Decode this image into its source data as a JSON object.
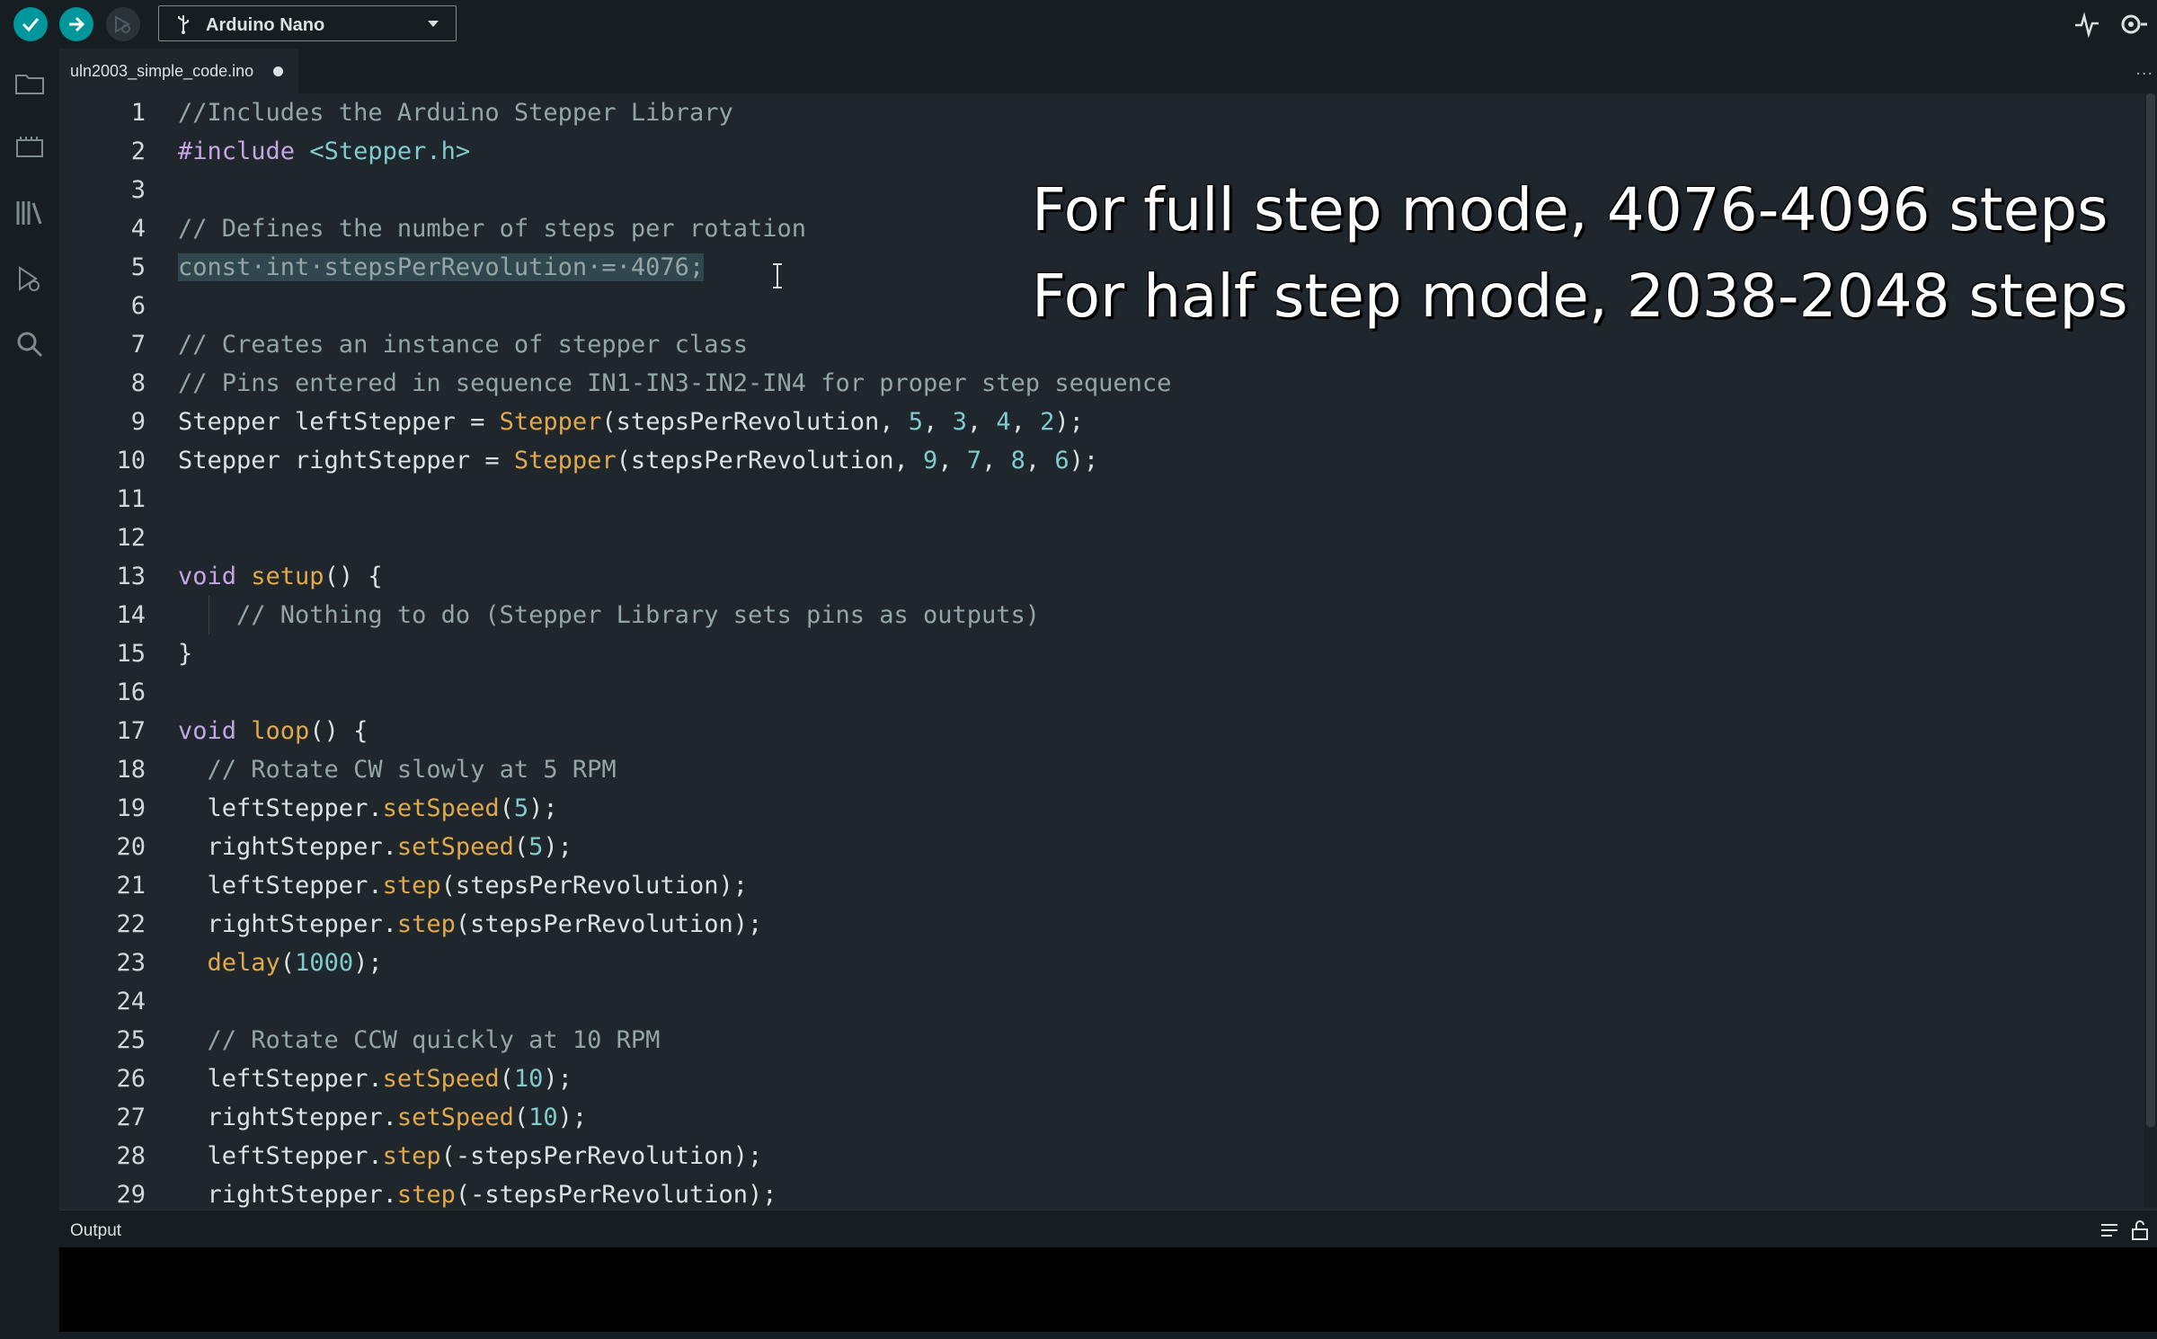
{
  "toolbar": {
    "board_name": "Arduino Nano"
  },
  "tab": {
    "filename": "uln2003_simple_code.ino",
    "more": "..."
  },
  "editor": {
    "lines": [
      {
        "n": "1",
        "segs": [
          {
            "t": "//Includes the Arduino Stepper Library",
            "c": "cmt"
          }
        ]
      },
      {
        "n": "2",
        "segs": [
          {
            "t": "#include ",
            "c": "pp"
          },
          {
            "t": "<Stepper.h>",
            "c": "inc"
          }
        ]
      },
      {
        "n": "3",
        "segs": []
      },
      {
        "n": "4",
        "segs": [
          {
            "t": "// Defines the number of steps per rotation",
            "c": "cmt"
          }
        ]
      },
      {
        "n": "5",
        "segs": [
          {
            "t": "const·int·stepsPerRevolution·=·4076;",
            "c": "sel"
          }
        ]
      },
      {
        "n": "6",
        "segs": []
      },
      {
        "n": "7",
        "segs": [
          {
            "t": "// Creates an instance of stepper class",
            "c": "cmt"
          }
        ]
      },
      {
        "n": "8",
        "segs": [
          {
            "t": "// Pins entered in sequence IN1-IN3-IN2-IN4 for proper step sequence",
            "c": "cmt"
          }
        ]
      },
      {
        "n": "9",
        "segs": [
          {
            "t": "Stepper leftStepper = ",
            "c": ""
          },
          {
            "t": "Stepper",
            "c": "fn"
          },
          {
            "t": "(stepsPerRevolution, ",
            "c": ""
          },
          {
            "t": "5",
            "c": "num"
          },
          {
            "t": ", ",
            "c": ""
          },
          {
            "t": "3",
            "c": "num"
          },
          {
            "t": ", ",
            "c": ""
          },
          {
            "t": "4",
            "c": "num"
          },
          {
            "t": ", ",
            "c": ""
          },
          {
            "t": "2",
            "c": "num"
          },
          {
            "t": ");",
            "c": ""
          }
        ]
      },
      {
        "n": "10",
        "segs": [
          {
            "t": "Stepper rightStepper = ",
            "c": ""
          },
          {
            "t": "Stepper",
            "c": "fn"
          },
          {
            "t": "(stepsPerRevolution, ",
            "c": ""
          },
          {
            "t": "9",
            "c": "num"
          },
          {
            "t": ", ",
            "c": ""
          },
          {
            "t": "7",
            "c": "num"
          },
          {
            "t": ", ",
            "c": ""
          },
          {
            "t": "8",
            "c": "num"
          },
          {
            "t": ", ",
            "c": ""
          },
          {
            "t": "6",
            "c": "num"
          },
          {
            "t": ");",
            "c": ""
          }
        ]
      },
      {
        "n": "11",
        "segs": []
      },
      {
        "n": "12",
        "segs": []
      },
      {
        "n": "13",
        "segs": [
          {
            "t": "void ",
            "c": "kw"
          },
          {
            "t": "setup",
            "c": "fn"
          },
          {
            "t": "() {",
            "c": ""
          }
        ]
      },
      {
        "n": "14",
        "guide": true,
        "segs": [
          {
            "t": "    // Nothing to do (Stepper Library sets pins as outputs)",
            "c": "cmt"
          }
        ]
      },
      {
        "n": "15",
        "segs": [
          {
            "t": "}",
            "c": ""
          }
        ]
      },
      {
        "n": "16",
        "segs": []
      },
      {
        "n": "17",
        "segs": [
          {
            "t": "void ",
            "c": "kw"
          },
          {
            "t": "loop",
            "c": "fn"
          },
          {
            "t": "() {",
            "c": ""
          }
        ]
      },
      {
        "n": "18",
        "segs": [
          {
            "t": "  // Rotate CW slowly at 5 RPM",
            "c": "cmt"
          }
        ]
      },
      {
        "n": "19",
        "segs": [
          {
            "t": "  leftStepper.",
            "c": ""
          },
          {
            "t": "setSpeed",
            "c": "fn"
          },
          {
            "t": "(",
            "c": ""
          },
          {
            "t": "5",
            "c": "num"
          },
          {
            "t": ");",
            "c": ""
          }
        ]
      },
      {
        "n": "20",
        "segs": [
          {
            "t": "  rightStepper.",
            "c": ""
          },
          {
            "t": "setSpeed",
            "c": "fn"
          },
          {
            "t": "(",
            "c": ""
          },
          {
            "t": "5",
            "c": "num"
          },
          {
            "t": ");",
            "c": ""
          }
        ]
      },
      {
        "n": "21",
        "segs": [
          {
            "t": "  leftStepper.",
            "c": ""
          },
          {
            "t": "step",
            "c": "fn"
          },
          {
            "t": "(stepsPerRevolution);",
            "c": ""
          }
        ]
      },
      {
        "n": "22",
        "segs": [
          {
            "t": "  rightStepper.",
            "c": ""
          },
          {
            "t": "step",
            "c": "fn"
          },
          {
            "t": "(stepsPerRevolution);",
            "c": ""
          }
        ]
      },
      {
        "n": "23",
        "segs": [
          {
            "t": "  ",
            "c": ""
          },
          {
            "t": "delay",
            "c": "fn"
          },
          {
            "t": "(",
            "c": ""
          },
          {
            "t": "1000",
            "c": "num"
          },
          {
            "t": ");",
            "c": ""
          }
        ]
      },
      {
        "n": "24",
        "segs": []
      },
      {
        "n": "25",
        "segs": [
          {
            "t": "  // Rotate CCW quickly at 10 RPM",
            "c": "cmt"
          }
        ]
      },
      {
        "n": "26",
        "segs": [
          {
            "t": "  leftStepper.",
            "c": ""
          },
          {
            "t": "setSpeed",
            "c": "fn"
          },
          {
            "t": "(",
            "c": ""
          },
          {
            "t": "10",
            "c": "num"
          },
          {
            "t": ");",
            "c": ""
          }
        ]
      },
      {
        "n": "27",
        "segs": [
          {
            "t": "  rightStepper.",
            "c": ""
          },
          {
            "t": "setSpeed",
            "c": "fn"
          },
          {
            "t": "(",
            "c": ""
          },
          {
            "t": "10",
            "c": "num"
          },
          {
            "t": ");",
            "c": ""
          }
        ]
      },
      {
        "n": "28",
        "segs": [
          {
            "t": "  leftStepper.",
            "c": ""
          },
          {
            "t": "step",
            "c": "fn"
          },
          {
            "t": "(-stepsPerRevolution);",
            "c": ""
          }
        ]
      },
      {
        "n": "29",
        "segs": [
          {
            "t": "  rightStepper.",
            "c": ""
          },
          {
            "t": "step",
            "c": "fn"
          },
          {
            "t": "(-stepsPerRevolution);",
            "c": ""
          }
        ]
      }
    ]
  },
  "overlay": {
    "line1": "For full step mode, 4076-4096 steps",
    "line2": "For half step mode, 2038-2048 steps"
  },
  "output": {
    "label": "Output"
  },
  "icons": {
    "verify": "check-icon",
    "upload": "arrow-right-icon",
    "debug": "debug-icon",
    "usb": "usb-icon",
    "sketchbook": "folder-icon",
    "boards": "board-icon",
    "library": "library-icon",
    "debugger": "debugger-icon",
    "search": "search-icon",
    "serial_plotter": "pulse-icon",
    "serial_monitor": "serial-monitor-icon"
  },
  "colors": {
    "accent": "#00979c",
    "background": "#1f272d",
    "panel": "#171e21",
    "selection": "#31474f"
  }
}
